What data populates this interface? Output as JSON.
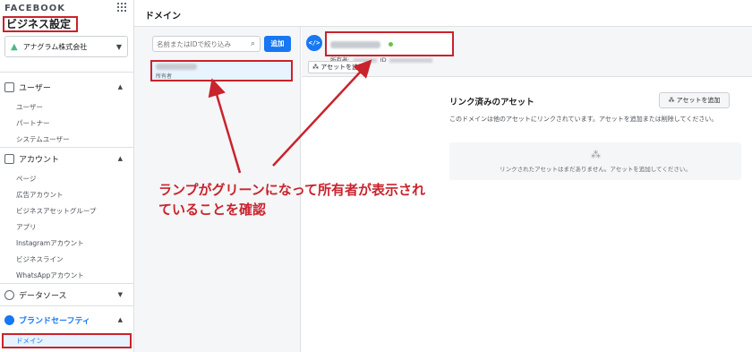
{
  "sidebar": {
    "brand": "FACEBOOK",
    "title": "ビジネス設定",
    "account": "アナグラム株式会社",
    "sections": [
      {
        "label": "ユーザー",
        "items": [
          "ユーザー",
          "パートナー",
          "システムユーザー"
        ]
      },
      {
        "label": "アカウント",
        "items": [
          "ページ",
          "広告アカウント",
          "ビジネスアセットグループ",
          "アプリ",
          "Instagramアカウント",
          "ビジネスライン",
          "WhatsAppアカウント"
        ]
      },
      {
        "label": "データソース",
        "items": []
      },
      {
        "label": "ブランドセーフティ",
        "items": [
          "ドメイン"
        ]
      }
    ]
  },
  "header": {
    "title": "ドメイン"
  },
  "list": {
    "search_placeholder": "名前またはIDで絞り込み",
    "add_label": "追加",
    "item_owner": "所有者"
  },
  "detail": {
    "owner_label": "所有者:",
    "id_label": "ID",
    "add_asset_label": "アセットを追加",
    "status_color": "#6cc04a"
  },
  "linked": {
    "title": "リンク済みのアセット",
    "add_label": "アセットを追加",
    "description": "このドメインは他のアセットにリンクされています。アセットを追加または削除してください。",
    "empty_text": "リンクされたアセットはまだありません。アセットを追加してください。"
  },
  "annotation": {
    "line1": "ランプがグリーンになって所有者が表示され",
    "line2": "ていることを確認",
    "color": "#c9232d"
  }
}
